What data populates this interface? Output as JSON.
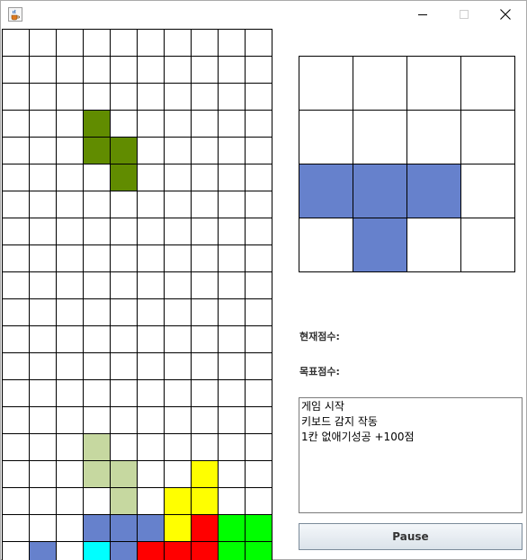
{
  "window": {
    "icon": "java-cup-icon",
    "controls": [
      "minimize-icon",
      "maximize-icon",
      "close-icon"
    ]
  },
  "colors": {
    "S": "#618c00",
    "Sg": "#c6d8a0",
    "T": "#6681cc",
    "O": "#ffff00",
    "Z": "#ff0000",
    "L": "#00ff00",
    "I": "#00ffff"
  },
  "board": {
    "cols": 10,
    "rows": 20,
    "cells": [
      "..........",
      "..........",
      "..........",
      "...S......",
      "...SS.....",
      "....S.....",
      "..........",
      "..........",
      "..........",
      "..........",
      "..........",
      "..........",
      "..........",
      "..........",
      "..........",
      "...g......",
      "...gg..O..",
      "....g.OO..",
      "...TTTOZLL",
      ".T.ITZZZLL"
    ]
  },
  "next_piece": {
    "cols": 4,
    "rows": 4,
    "cells": [
      "....",
      "....",
      "TTT.",
      ".T.."
    ]
  },
  "score": {
    "label": "현재점수:"
  },
  "target": {
    "label": "목표점수:"
  },
  "log": {
    "lines": [
      "게임 시작",
      "키보드 감지 작동",
      "1칸 없애기성공 +100점"
    ]
  },
  "pause_button": {
    "label": "Pause"
  }
}
